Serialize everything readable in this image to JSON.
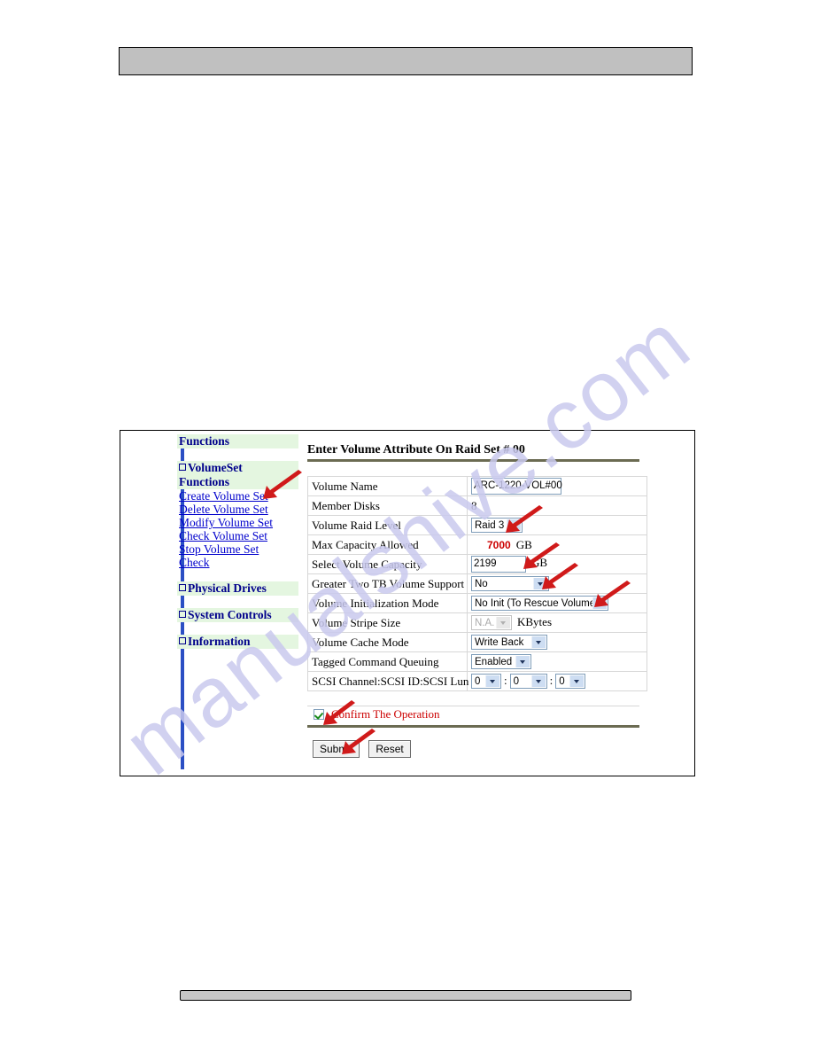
{
  "watermark": {
    "text": "manualshive.com"
  },
  "sidebar": {
    "heading": "Functions",
    "groups": [
      {
        "label": "VolumeSet",
        "sub": "Functions"
      }
    ],
    "links": [
      {
        "label": "Create Volume Set"
      },
      {
        "label": "Delete Volume Set"
      },
      {
        "label": "Modify Volume Set"
      },
      {
        "label": "Check Volume Set"
      },
      {
        "label": "Stop Volume Set"
      },
      {
        "label": "Check"
      }
    ],
    "sections": [
      {
        "label": "Physical Drives"
      },
      {
        "label": "System Controls"
      },
      {
        "label": "Information"
      }
    ]
  },
  "main": {
    "title": "Enter Volume Attribute On Raid Set # 00",
    "fields": [
      {
        "label": "Volume Name",
        "type": "text",
        "value": "ARC-1220-VOL#00"
      },
      {
        "label": "Member Disks",
        "type": "static",
        "value": "8"
      },
      {
        "label": "Volume Raid Level",
        "type": "select",
        "value": "Raid 3"
      },
      {
        "label": "Max Capacity Allowed",
        "type": "redvalue",
        "value": "7000",
        "unit": "GB"
      },
      {
        "label": "Select Volume Capacity",
        "type": "text",
        "value": "2199",
        "unit": "GB"
      },
      {
        "label": "Greater Two TB Volume Support",
        "type": "select",
        "value": "No"
      },
      {
        "label": "Volume Initialization Mode",
        "type": "select",
        "value": "No Init (To Rescue Volume)"
      },
      {
        "label": "Volume Stripe Size",
        "type": "select-disabled",
        "value": "N.A.",
        "unit": "KBytes"
      },
      {
        "label": "Volume Cache Mode",
        "type": "select",
        "value": "Write Back"
      },
      {
        "label": "Tagged Command Queuing",
        "type": "select",
        "value": "Enabled"
      },
      {
        "label": "SCSI Channel:SCSI ID:SCSI Lun",
        "type": "triple",
        "value": "0",
        "value2": "0",
        "value3": "0",
        "separator": ":"
      }
    ],
    "confirm": {
      "label": "Confirm The Operation",
      "checked": true
    },
    "buttons": {
      "submit": "Submit",
      "reset": "Reset"
    }
  },
  "colors": {
    "nav_link": "#0000cc",
    "nav_heading": "#00008b",
    "nav_band": "#e4f6e0",
    "accent_rule": "#6b6b52",
    "red_value": "#cc0000",
    "annotation_arrow": "#d01a1a",
    "watermark": "#c9c9ee"
  }
}
